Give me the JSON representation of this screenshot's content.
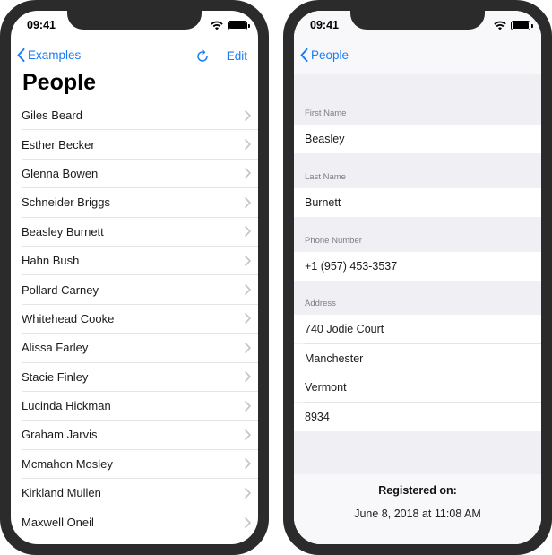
{
  "status_bar": {
    "time": "09:41"
  },
  "list_screen": {
    "back_label": "Examples",
    "edit_label": "Edit",
    "title": "People",
    "people": [
      "Giles Beard",
      "Esther Becker",
      "Glenna Bowen",
      "Schneider Briggs",
      "Beasley Burnett",
      "Hahn Bush",
      "Pollard Carney",
      "Whitehead Cooke",
      "Alissa Farley",
      "Stacie Finley",
      "Lucinda Hickman",
      "Graham Jarvis",
      "Mcmahon Mosley",
      "Kirkland Mullen",
      "Maxwell Oneil"
    ]
  },
  "detail_screen": {
    "back_label": "People",
    "first_name_header": "First Name",
    "first_name": "Beasley",
    "last_name_header": "Last Name",
    "last_name": "Burnett",
    "phone_header": "Phone Number",
    "phone": "+1 (957) 453-3537",
    "address_header": "Address",
    "address": [
      "740 Jodie Court",
      "Manchester",
      "Vermont",
      "8934"
    ],
    "registered_label": "Registered on:",
    "registered_date": "June 8, 2018 at 11:08 AM"
  },
  "colors": {
    "accent": "#1a7cf5",
    "bezel": "#2b2b2b",
    "grouped_bg": "#f0f0f4"
  }
}
